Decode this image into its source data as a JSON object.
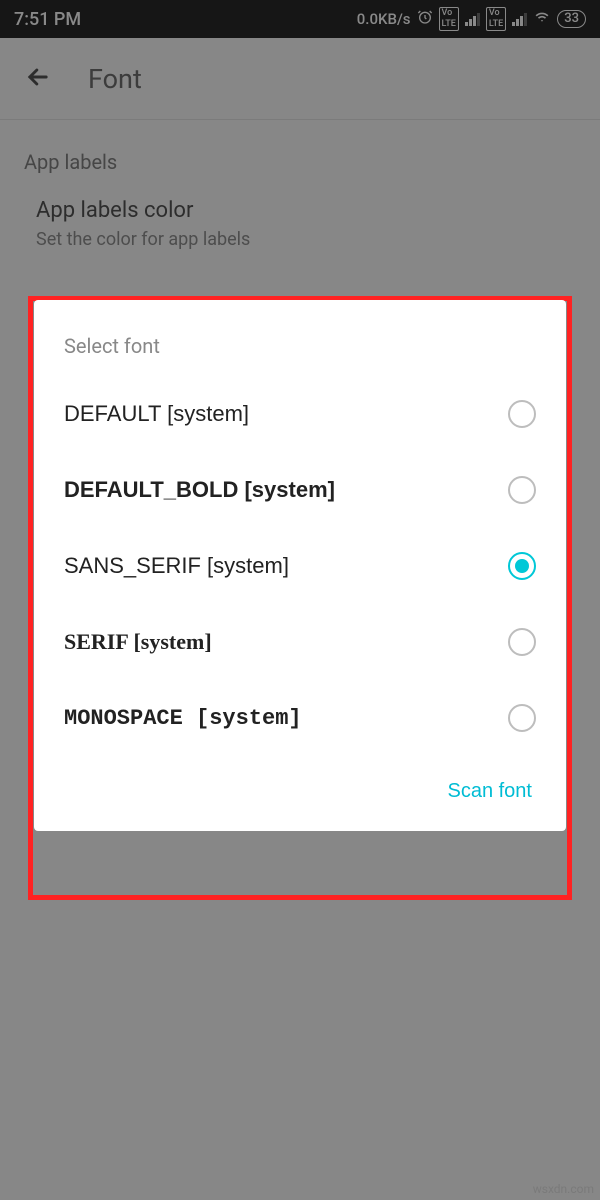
{
  "status_bar": {
    "time": "7:51 PM",
    "net_speed": "0.0KB/s",
    "battery": "33"
  },
  "app_bar": {
    "title": "Font"
  },
  "section": {
    "header": "App labels",
    "item_title": "App labels color",
    "item_sub": "Set the color for app labels"
  },
  "dialog": {
    "title": "Select font",
    "options": [
      {
        "label": "DEFAULT [system]",
        "selected": false
      },
      {
        "label": "DEFAULT_BOLD [system]",
        "selected": false
      },
      {
        "label": "SANS_SERIF [system]",
        "selected": true
      },
      {
        "label": "SERIF [system]",
        "selected": false
      },
      {
        "label": "MONOSPACE [system]",
        "selected": false
      }
    ],
    "action": "Scan font"
  },
  "watermark": "wsxdn.com"
}
